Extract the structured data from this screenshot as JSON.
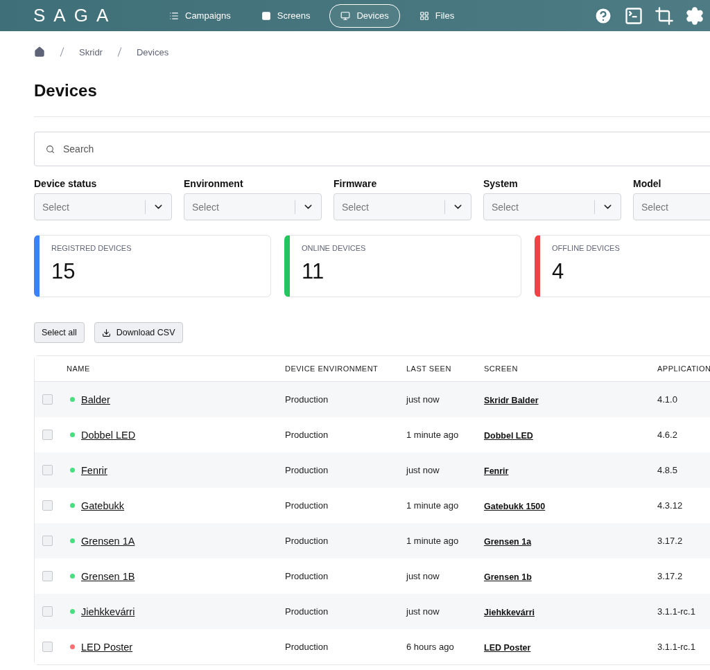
{
  "nav": {
    "logo": "SAGA",
    "items": [
      {
        "label": "Campaigns",
        "selected": false
      },
      {
        "label": "Screens",
        "selected": false
      },
      {
        "label": "Devices",
        "selected": true
      },
      {
        "label": "Files",
        "selected": false
      }
    ]
  },
  "breadcrumb": [
    "Skridr",
    "Devices"
  ],
  "title": "Devices",
  "search": {
    "placeholder": "Search"
  },
  "filters": [
    {
      "label": "Device status",
      "placeholder": "Select"
    },
    {
      "label": "Environment",
      "placeholder": "Select"
    },
    {
      "label": "Firmware",
      "placeholder": "Select"
    },
    {
      "label": "System",
      "placeholder": "Select"
    },
    {
      "label": "Model",
      "placeholder": "Select"
    }
  ],
  "stats": [
    {
      "label": "REGISTRED DEVICES",
      "value": "15",
      "color": "#3b82f6"
    },
    {
      "label": "ONLINE DEVICES",
      "value": "11",
      "color": "#22c55e"
    },
    {
      "label": "OFFLINE DEVICES",
      "value": "4",
      "color": "#ef4444"
    }
  ],
  "actions": [
    "Select all",
    "Download CSV"
  ],
  "table": {
    "columns": [
      "NAME",
      "DEVICE ENVIRONMENT",
      "LAST SEEN",
      "SCREEN",
      "APPLICATION"
    ],
    "rows": [
      {
        "checked": false,
        "online": true,
        "name": "Balder",
        "environment": "Production",
        "last_seen": "just now",
        "screen": "Skridr Balder",
        "application": "4.1.0"
      },
      {
        "checked": false,
        "online": true,
        "name": "Dobbel LED",
        "environment": "Production",
        "last_seen": "1 minute ago",
        "screen": "Dobbel LED",
        "application": "4.6.2"
      },
      {
        "checked": false,
        "online": true,
        "name": "Fenrir",
        "environment": "Production",
        "last_seen": "just now",
        "screen": "Fenrir",
        "application": "4.8.5"
      },
      {
        "checked": false,
        "online": true,
        "name": "Gatebukk",
        "environment": "Production",
        "last_seen": "1 minute ago",
        "screen": "Gatebukk 1500",
        "application": "4.3.12"
      },
      {
        "checked": false,
        "online": true,
        "name": "Grensen 1A",
        "environment": "Production",
        "last_seen": "1 minute ago",
        "screen": "Grensen 1a",
        "application": "3.17.2"
      },
      {
        "checked": false,
        "online": true,
        "name": "Grensen 1B",
        "environment": "Production",
        "last_seen": "just now",
        "screen": "Grensen 1b",
        "application": "3.17.2"
      },
      {
        "checked": false,
        "online": true,
        "name": "Jiehkkevárri",
        "environment": "Production",
        "last_seen": "just now",
        "screen": "Jiehkkevárri",
        "application": "3.1.1-rc.1"
      },
      {
        "checked": false,
        "online": false,
        "name": "LED Poster",
        "environment": "Production",
        "last_seen": "6 hours ago",
        "screen": "LED Poster",
        "application": "3.1.1-rc.1"
      }
    ]
  }
}
